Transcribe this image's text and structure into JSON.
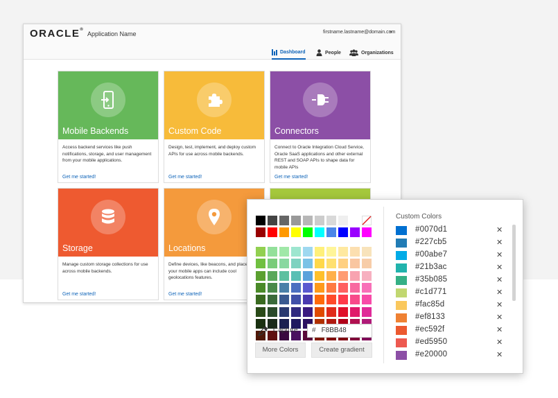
{
  "header": {
    "logo": "ORACLE",
    "logo_mark": "®",
    "app_name": "Application Name",
    "user": "firstname.lastname@domain.com",
    "user_caret": "▼"
  },
  "nav": {
    "dashboard": "Dashboard",
    "people": "People",
    "organizations": "Organizations"
  },
  "tiles": [
    {
      "title": "Mobile Backends",
      "desc": "Access backend services like push notifications, storage, and user management from your mobile applications.",
      "link": "Get me started!",
      "color": "#66b85a",
      "icon": "phone-login-icon"
    },
    {
      "title": "Custom Code",
      "desc": "Design, test, implement, and deploy custom APIs for use across mobile backends.",
      "link": "Get me started!",
      "color": "#f7bb3a",
      "icon": "puzzle-icon"
    },
    {
      "title": "Connectors",
      "desc": "Connect to Oracle Integration Cloud Service, Oracle SaaS applications and other external REST and SOAP APIs to shape data for mobile APIs",
      "link": "Get me started!",
      "color": "#8c4fa6",
      "icon": "plug-icon"
    },
    {
      "title": "Storage",
      "desc": "Manage custom storage collections for use across mobile backends.",
      "link": "Get me started!",
      "color": "#ee5a30",
      "icon": "database-icon"
    },
    {
      "title": "Locations",
      "desc": "Define devices, like beacons, and places so your mobile apps can include cool geolocations features.",
      "link": "Get me started!",
      "color": "#f49a3c",
      "icon": "location-pin-icon"
    }
  ],
  "picker": {
    "capture_label": "Capture",
    "hex_prefix": "#",
    "hex_value": "F8BB48",
    "more_colors": "More Colors",
    "create_gradient": "Create gradient",
    "custom_colors_title": "Custom Colors",
    "remove_symbol": "✕",
    "custom_colors": [
      {
        "hex": "#0070d1"
      },
      {
        "hex": "#227cb5"
      },
      {
        "hex": "#00abe7"
      },
      {
        "hex": "#21b3ac"
      },
      {
        "hex": "#35b085"
      },
      {
        "hex": "#c1d771"
      },
      {
        "hex": "#fac85d"
      },
      {
        "hex": "#ef8133"
      },
      {
        "hex": "#ec592f"
      },
      {
        "hex": "#ed5950"
      },
      {
        "hex": "#e20000"
      }
    ],
    "custom_colors_display": [
      "#0070d1",
      "#227cb5",
      "#00abe7",
      "#21b3ac",
      "#35b085",
      "#c1d771",
      "#fac85d",
      "#ef8133",
      "#ec592f",
      "#ed5950",
      "#8c4fa6"
    ],
    "gray_row": [
      "#000000",
      "#444444",
      "#666666",
      "#999999",
      "#b7b7b7",
      "#cccccc",
      "#d9d9d9",
      "#efefef",
      "#ffffff",
      "none"
    ],
    "bright_row": [
      "#990000",
      "#ff0000",
      "#ff9900",
      "#ffff00",
      "#00ff00",
      "#00ffff",
      "#4a86e8",
      "#0000ff",
      "#9900ff",
      "#ff00ff"
    ],
    "grid": [
      [
        "#92d050",
        "#93e09a",
        "#a0e8a8",
        "#9de6cf",
        "#9ed8f0",
        "#fff07a",
        "#fff599",
        "#ffe9a0",
        "#fcdfb0",
        "#f8e3bb"
      ],
      [
        "#70c040",
        "#7acc7a",
        "#88d8a0",
        "#7ed2c0",
        "#7ac2e6",
        "#ffd84a",
        "#ffe070",
        "#ffd082",
        "#f9c6a0",
        "#f7cda8"
      ],
      [
        "#5ba030",
        "#5aa85a",
        "#5ec0a0",
        "#5abfb4",
        "#5aa2dc",
        "#ffc02a",
        "#ffb04a",
        "#ff9c72",
        "#f8a3b0",
        "#f7b0c0"
      ],
      [
        "#4a8a28",
        "#4a8a4a",
        "#4a80a8",
        "#4b6fc0",
        "#5a5ad0",
        "#ff9a1a",
        "#ff7a42",
        "#ff6060",
        "#f86aa0",
        "#f870b8"
      ],
      [
        "#3a6a20",
        "#3a6a3a",
        "#3a5a90",
        "#4050a8",
        "#4a3ab0",
        "#ff6a0a",
        "#ff4a2a",
        "#ff3a4a",
        "#f84a8a",
        "#f84aa8"
      ],
      [
        "#2a4a18",
        "#2a4a2a",
        "#2a3a70",
        "#302a80",
        "#3a1a80",
        "#e04a00",
        "#e02a1a",
        "#e0102a",
        "#e01a6a",
        "#e02a98"
      ],
      [
        "#1a3010",
        "#1a2a1a",
        "#1a2050",
        "#201a60",
        "#2a1060",
        "#b03000",
        "#b01a10",
        "#b00018",
        "#b01050",
        "#b01a78"
      ],
      [
        "#501808",
        "#601010",
        "#3a0a40",
        "#4a1060",
        "#5a0a3a",
        "#801800",
        "#800a08",
        "#800010",
        "#800a3a",
        "#800a58"
      ]
    ]
  }
}
